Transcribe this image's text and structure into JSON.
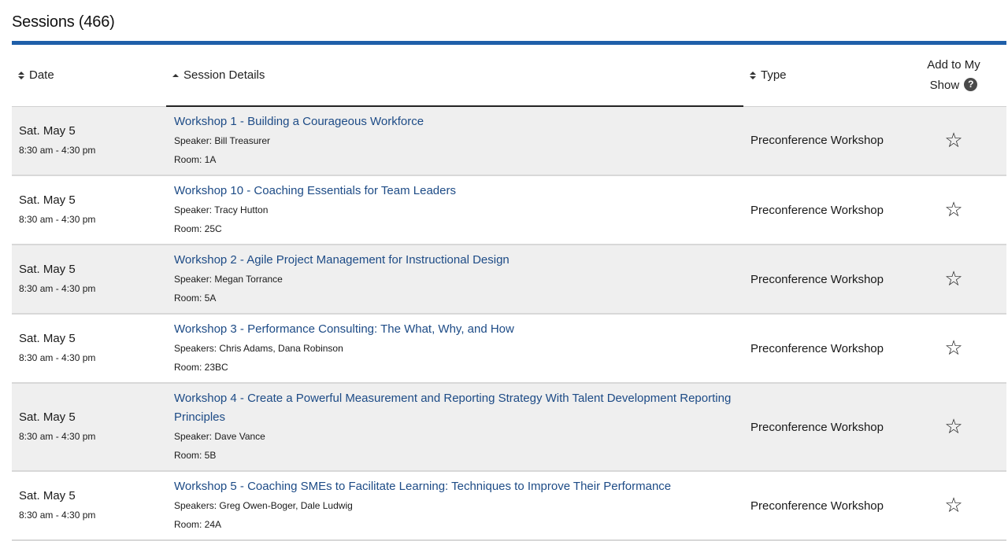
{
  "header": {
    "title": "Sessions (466)"
  },
  "table": {
    "columns": {
      "date": "Date",
      "details": "Session Details",
      "type": "Type",
      "add_line1": "Add to My",
      "add_line2": "Show",
      "help_glyph": "?"
    },
    "star_glyph": "☆",
    "rows": [
      {
        "date": "Sat. May 5",
        "time": "8:30 am - 4:30 pm",
        "title": "Workshop 1 - Building a Courageous Workforce",
        "speaker": "Speaker: Bill Treasurer",
        "room": "Room: 1A",
        "type": "Preconference Workshop"
      },
      {
        "date": "Sat. May 5",
        "time": "8:30 am - 4:30 pm",
        "title": "Workshop 10 - Coaching Essentials for Team Leaders",
        "speaker": "Speaker: Tracy Hutton",
        "room": "Room: 25C",
        "type": "Preconference Workshop"
      },
      {
        "date": "Sat. May 5",
        "time": "8:30 am - 4:30 pm",
        "title": "Workshop 2 - Agile Project Management for Instructional Design",
        "speaker": "Speaker: Megan Torrance",
        "room": "Room: 5A",
        "type": "Preconference Workshop"
      },
      {
        "date": "Sat. May 5",
        "time": "8:30 am - 4:30 pm",
        "title": "Workshop 3 - Performance Consulting: The What, Why, and How",
        "speaker": "Speakers: Chris Adams, Dana Robinson",
        "room": "Room: 23BC",
        "type": "Preconference Workshop"
      },
      {
        "date": "Sat. May 5",
        "time": "8:30 am - 4:30 pm",
        "title": "Workshop 4 - Create a Powerful Measurement and Reporting Strategy With Talent Development Reporting Principles",
        "speaker": "Speaker: Dave Vance",
        "room": "Room: 5B",
        "type": "Preconference Workshop"
      },
      {
        "date": "Sat. May 5",
        "time": "8:30 am - 4:30 pm",
        "title": "Workshop 5 - Coaching SMEs to Facilitate Learning: Techniques to Improve Their Performance",
        "speaker": "Speakers: Greg Owen-Boger, Dale Ludwig",
        "room": "Room: 24A",
        "type": "Preconference Workshop"
      }
    ]
  }
}
